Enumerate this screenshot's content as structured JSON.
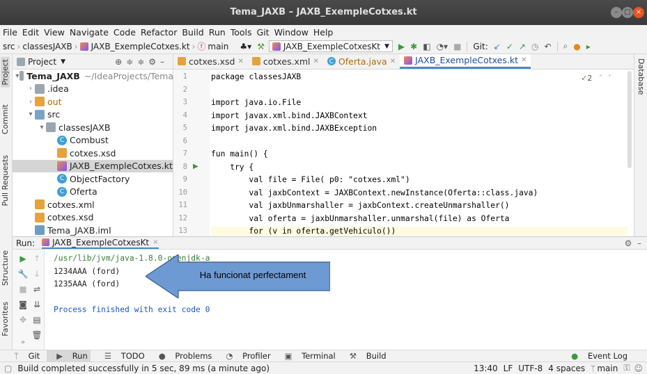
{
  "window": {
    "title": "Tema_JAXB – JAXB_ExempleCotxes.kt"
  },
  "menu": [
    "File",
    "Edit",
    "View",
    "Navigate",
    "Code",
    "Refactor",
    "Build",
    "Run",
    "Tools",
    "Git",
    "Window",
    "Help"
  ],
  "nav": {
    "crumbs": [
      "src",
      "classesJAXB",
      "JAXB_ExempleCotxes.kt",
      "main"
    ],
    "run_config": "JAXB_ExempleCotxesKt",
    "git_label": "Git:"
  },
  "project": {
    "header": "Project",
    "tree": [
      {
        "label": "Tema_JAXB",
        "extra": "~/IdeaProjects/Tema",
        "indent": 0,
        "arrow": "▾",
        "icon": "folder"
      },
      {
        "label": ".idea",
        "indent": 1,
        "arrow": "›",
        "icon": "folder"
      },
      {
        "label": "out",
        "indent": 1,
        "arrow": "›",
        "icon": "folder orange"
      },
      {
        "label": "src",
        "indent": 1,
        "arrow": "▾",
        "icon": "folder blue"
      },
      {
        "label": "classesJAXB",
        "indent": 2,
        "arrow": "▾",
        "icon": "folder"
      },
      {
        "label": "Combust",
        "indent": 3,
        "arrow": "",
        "icon": "cls"
      },
      {
        "label": "cotxes.xsd",
        "indent": 3,
        "arrow": "",
        "icon": "xml"
      },
      {
        "label": "JAXB_ExempleCotxes.kt",
        "indent": 3,
        "arrow": "",
        "icon": "kt",
        "selected": true
      },
      {
        "label": "ObjectFactory",
        "indent": 3,
        "arrow": "",
        "icon": "cls"
      },
      {
        "label": "Oferta",
        "indent": 3,
        "arrow": "",
        "icon": "cls"
      },
      {
        "label": "cotxes.xml",
        "indent": 1,
        "arrow": "",
        "icon": "xml"
      },
      {
        "label": "cotxes.xsd",
        "indent": 1,
        "arrow": "",
        "icon": "xml"
      },
      {
        "label": "Tema_JAXB.iml",
        "indent": 1,
        "arrow": "",
        "icon": "iml"
      }
    ]
  },
  "editor": {
    "tabs": [
      {
        "label": "cotxes.xsd",
        "active": false
      },
      {
        "label": "cotxes.xml",
        "active": false
      },
      {
        "label": "Oferta.java",
        "active": false
      },
      {
        "label": "JAXB_ExempleCotxes.kt",
        "active": true
      }
    ],
    "inspection_count": "2",
    "line_numbers": [
      "1",
      "2",
      "3",
      "4",
      "5",
      "6",
      "7",
      "8",
      "9",
      "10",
      "11",
      "12",
      "13"
    ],
    "lines": [
      "package classesJAXB",
      "",
      "import java.io.File",
      "import javax.xml.bind.JAXBContext",
      "import javax.xml.bind.JAXBException",
      "",
      "fun main() {",
      "    try {",
      "        val file = File( p0: \"cotxes.xml\")",
      "        val jaxbContext = JAXBContext.newInstance(Oferta::class.java)",
      "        val jaxbUnmarshaller = jaxbContext.createUnmarshaller()",
      "        val oferta = jaxbUnmarshaller.unmarshal(file) as Oferta",
      "        for (v in oferta.getVehiculo())"
    ]
  },
  "run": {
    "label": "Run:",
    "tab": "JAXB_ExempleCotxesKt",
    "output": [
      "/usr/lib/jvm/java-1.8.0-openjdk-a",
      "1234AAA (ford)",
      "1235AAA (ford)",
      "",
      "Process finished with exit code 0"
    ],
    "callout": "Ha funcionat perfectament"
  },
  "side_tabs": {
    "left_top": [
      "Project",
      "Commit",
      "Pull Requests"
    ],
    "left_bottom": [
      "Structure",
      "Favorites"
    ],
    "right": [
      "Database"
    ]
  },
  "bottom_tabs": [
    "Git",
    "Run",
    "TODO",
    "Problems",
    "Profiler",
    "Terminal",
    "Build"
  ],
  "event_log": "Event Log",
  "status": {
    "message": "Build completed successfully in 5 sec, 89 ms (a minute ago)",
    "position": "13:40",
    "line_sep": "LF",
    "encoding": "UTF-8",
    "indent": "4 spaces",
    "branch": "main"
  }
}
